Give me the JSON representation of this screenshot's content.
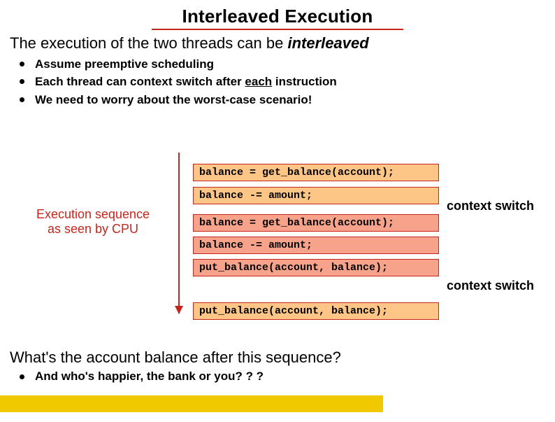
{
  "title": "Interleaved Execution",
  "lead_prefix": "The execution of the two threads can be ",
  "lead_emph": "interleaved",
  "bullets": [
    {
      "text": "Assume preemptive scheduling"
    },
    {
      "pre": "Each thread can context switch after ",
      "under": "each",
      "post": " instruction"
    },
    {
      "text": "We need to worry about the worst-case scenario!"
    }
  ],
  "seq_label_1": "Execution sequence",
  "seq_label_2": "as seen by CPU",
  "code": {
    "a1": "balance = get_balance(account);",
    "a2": "balance -= amount;",
    "b1": "balance = get_balance(account);",
    "b2": "balance -= amount;",
    "b3": "put_balance(account, balance);",
    "a3": "put_balance(account, balance);"
  },
  "ctx_label": "context switch",
  "q2": "What's the account balance after this sequence?",
  "q2_bullet": "And who's happier, the bank or you? ? ?"
}
